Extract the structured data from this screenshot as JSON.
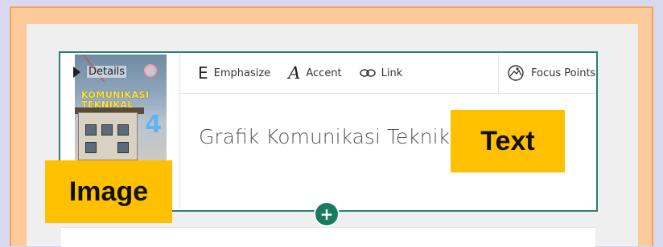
{
  "card": {
    "details_label": "Details",
    "book_cover": {
      "title_line1": "KOMUNIKASI",
      "title_line2": "TEKNIKAL",
      "number": "4"
    },
    "toolbar": {
      "emphasize_label": "Emphasize",
      "emphasize_icon": "E",
      "accent_label": "Accent",
      "accent_icon": "A",
      "link_label": "Link",
      "focus_points_label": "Focus Points"
    },
    "title": "Grafik Komunikasi Teknikal"
  },
  "annotations": {
    "text_tag": "Text",
    "image_tag": "Image"
  },
  "add_button_symbol": "+",
  "colors": {
    "accent_green": "#187a5f",
    "card_border": "#2e7d6e",
    "annotation_yellow": "#ffc000",
    "outer_frame": "#fccb99",
    "background": "#d8d8f0"
  }
}
